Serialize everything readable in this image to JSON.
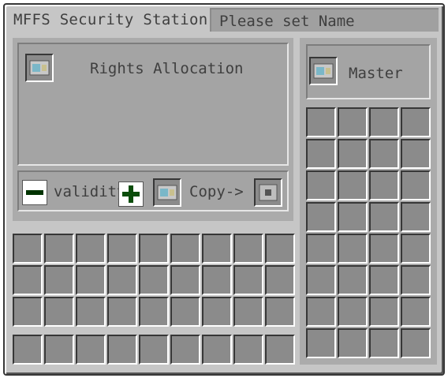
{
  "window": {
    "title": "MFFS Security Station:",
    "name_value": "Please set Name"
  },
  "rights": {
    "label": "Rights Allocation",
    "validity_label": "validity",
    "copy_label": "Copy->"
  },
  "master": {
    "label": "Master"
  },
  "icons": {
    "minus": "minus-icon",
    "plus": "plus-icon",
    "card": "id-card-icon",
    "blank_card": "blank-card-icon"
  },
  "colors": {
    "minus_green": "#003300",
    "plus_green": "#0b4d0b"
  }
}
